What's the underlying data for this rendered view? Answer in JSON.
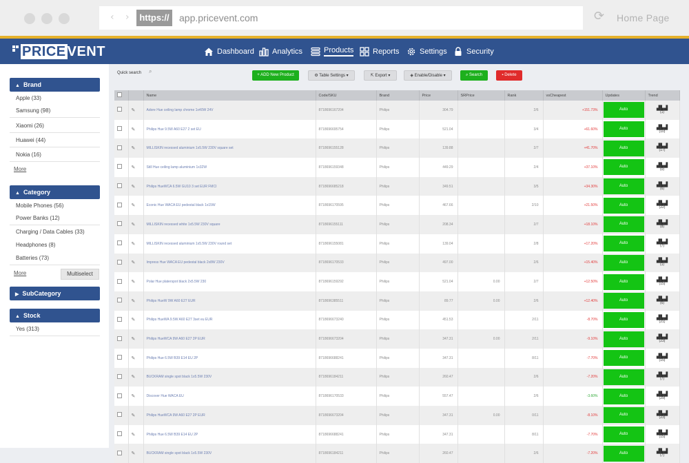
{
  "browser": {
    "https_badge": "https://",
    "url": "app.pricevent.com",
    "home_label": "Home Page"
  },
  "app": {
    "logo_price": "PRICE",
    "logo_vent": "VENT",
    "nav": [
      {
        "label": "Dashboard",
        "icon": "home-icon"
      },
      {
        "label": "Analytics",
        "icon": "bar-chart-icon"
      },
      {
        "label": "Products",
        "icon": "list-icon",
        "active": true
      },
      {
        "label": "Reports",
        "icon": "reports-icon"
      },
      {
        "label": "Settings",
        "icon": "gear-icon"
      },
      {
        "label": "Security",
        "icon": "lock-icon"
      }
    ]
  },
  "sidebar": {
    "brand": {
      "title": "Brand",
      "items": [
        "Apple (33)",
        "Samsung (98)",
        "Xiaomi (26)",
        "Huawei (44)",
        "Nokia (16)"
      ],
      "more": "More"
    },
    "category": {
      "title": "Category",
      "items": [
        "Mobile Phones (56)",
        "Power Banks (12)",
        "Charging / Data Cables (33)",
        "Headphones (8)",
        "Batteries (73)"
      ],
      "more": "More",
      "multiselect": "Multiselect"
    },
    "subcategory": {
      "title": "SubCategory"
    },
    "stock": {
      "title": "Stock",
      "items": [
        "Yes (313)"
      ]
    }
  },
  "toolbar": {
    "quick_search": "Quick search",
    "add": "+ ADD New Product",
    "table_settings": "Table Settings",
    "export": "Export",
    "enable_disable": "Enable/Disable",
    "search": "Search",
    "delete": "Delete"
  },
  "table": {
    "headers": [
      "",
      "",
      "Name",
      "Code/SKU",
      "Brand",
      "Price",
      "SRPrice",
      "Rank",
      "vsCheapest",
      "Updates",
      "Trend"
    ],
    "update_label": "Auto",
    "rows": [
      {
        "name": "Adore Hue ceiling lamp chrome 1x40W 24V",
        "sku": "8718696167204",
        "brand": "Philips",
        "price": "304.79",
        "srprice": "",
        "rank": "2/6",
        "vs": "+151.73%",
        "trend": "(1)"
      },
      {
        "name": "Philips Hue 9.5W A60 E27 2 set EU",
        "sku": "8718696695754",
        "brand": "Philips",
        "price": "521.04",
        "srprice": "",
        "rank": "3/4",
        "vs": "+61.60%",
        "trend": "(10)"
      },
      {
        "name": "MILLISKIN recessed aluminium 1x5.5W 230V square set",
        "sku": "8718696155128",
        "brand": "Philips",
        "price": "139.88",
        "srprice": "",
        "rank": "2/7",
        "vs": "+41.70%",
        "trend": "(17)"
      },
      {
        "name": "Still Hue ceiling lamp aluminium 1x32W",
        "sku": "8718696159348",
        "brand": "Philips",
        "price": "449.29",
        "srprice": "",
        "rank": "2/4",
        "vs": "+37.10%",
        "trend": "(0)"
      },
      {
        "name": "Philips HueWCA 6.5W GU10 3 set EUR FMCI",
        "sku": "8718696685218",
        "brand": "Philips",
        "price": "349.51",
        "srprice": "",
        "rank": "3/5",
        "vs": "+34.30%",
        "trend": "(6)"
      },
      {
        "name": "Econic Hue WACA EU pedestal black 1x15W",
        "sku": "8718696170595",
        "brand": "Philips",
        "price": "467.66",
        "srprice": "",
        "rank": "2/10",
        "vs": "+21.50%",
        "trend": "(22)"
      },
      {
        "name": "MILLISKIN recessed white 1x5.5W 230V square",
        "sku": "8718696155111",
        "brand": "Philips",
        "price": "208.34",
        "srprice": "",
        "rank": "2/7",
        "vs": "+18.10%",
        "trend": "(8)"
      },
      {
        "name": "MILLISKIN recessed aluminium 1x5.5W 230V round set",
        "sku": "8718696155081",
        "brand": "Philips",
        "price": "139.04",
        "srprice": "",
        "rank": "2/8",
        "vs": "+17.20%",
        "trend": "(7)"
      },
      {
        "name": "Impress Hue WACA EU pedestal black 2x8W 230V",
        "sku": "8718696170533",
        "brand": "Philips",
        "price": "497.00",
        "srprice": "",
        "rank": "2/6",
        "vs": "+15.40%",
        "trend": "(1)"
      },
      {
        "name": "Polar Hue platerspot black 2x5.5W 230",
        "sku": "8718696159292",
        "brand": "Philips",
        "price": "521.04",
        "srprice": "0.00",
        "rank": "2/7",
        "vs": "+12.50%",
        "trend": "(15)"
      },
      {
        "name": "Philips HueW 9W A60 E27 EUR",
        "sku": "8718696385511",
        "brand": "Philips",
        "price": "89.77",
        "srprice": "0.00",
        "rank": "2/6",
        "vs": "+12.40%",
        "trend": "(6)"
      },
      {
        "name": "Philips HueWA 9.5W A60 E27 3set eu EUR",
        "sku": "8718696673240",
        "brand": "Philips",
        "price": "451.53",
        "srprice": "",
        "rank": "2/11",
        "vs": "-8.70%",
        "trend": "(21)"
      },
      {
        "name": "Philips HueWCA 9W A60 E27 2P EUR",
        "sku": "8718696673204",
        "brand": "Philips",
        "price": "347.31",
        "srprice": "0.00",
        "rank": "2/11",
        "vs": "-9.10%",
        "trend": "(23)"
      },
      {
        "name": "Philips Hue 6.5W B39 E14 EU 2P",
        "sku": "8718696688241",
        "brand": "Philips",
        "price": "347.31",
        "srprice": "",
        "rank": "8/11",
        "vs": "-7.70%",
        "trend": "(15)"
      },
      {
        "name": "BUCKRAM single spot black 1x5.5W 230V",
        "sku": "8718696184211",
        "brand": "Philips",
        "price": "260.47",
        "srprice": "",
        "rank": "2/6",
        "vs": "-7.20%",
        "trend": "(7)"
      },
      {
        "name": "Discover Hue WACA EU",
        "sku": "8718696170533",
        "brand": "Philips",
        "price": "557.47",
        "srprice": "",
        "rank": "2/6",
        "vs": "-3.60%",
        "trend": "(29)",
        "green": true
      },
      {
        "name": "Philips HueWCA 9W A60 E27 2P EUR",
        "sku": "8718696673204",
        "brand": "Philips",
        "price": "347.31",
        "srprice": "0.00",
        "rank": "0/11",
        "vs": "-8.10%",
        "trend": "(23)"
      },
      {
        "name": "Philips Hue 6.5W B39 E14 EU 2P",
        "sku": "8718696688241",
        "brand": "Philips",
        "price": "347.31",
        "srprice": "",
        "rank": "8/11",
        "vs": "-7.70%",
        "trend": "(15)"
      },
      {
        "name": "BUCKRAM single spot black 1x5.5W 230V",
        "sku": "8718696184211",
        "brand": "Philips",
        "price": "260.47",
        "srprice": "",
        "rank": "2/6",
        "vs": "-7.20%",
        "trend": "(7)"
      }
    ]
  }
}
